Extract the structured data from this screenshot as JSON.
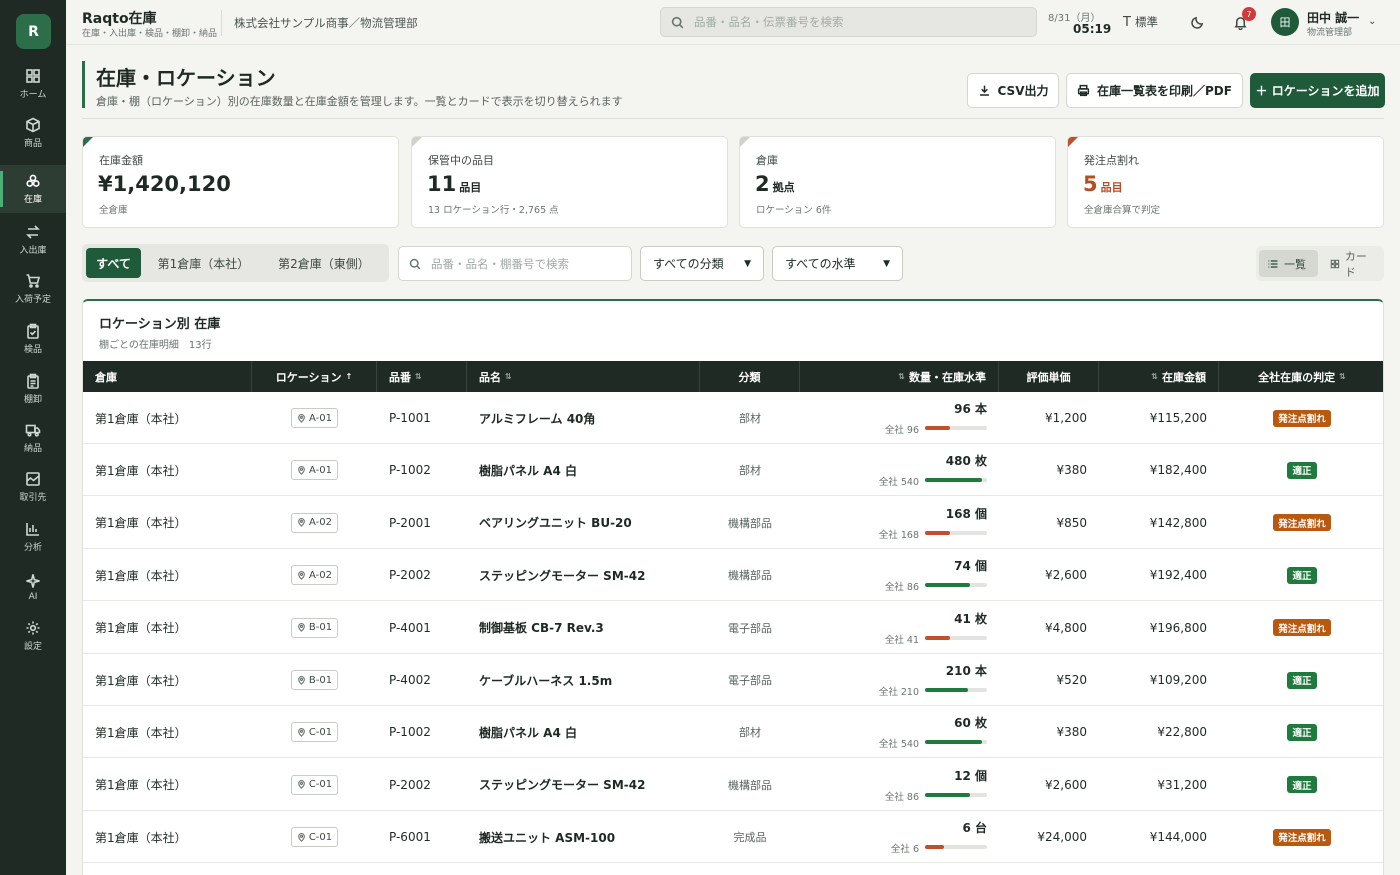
{
  "app": {
    "logo": "R",
    "title": "Raqto在庫",
    "subtitle": "在庫・入出庫・検品・棚卸・納品",
    "company": "株式会社サンプル商事／物流管理部"
  },
  "top_search": {
    "placeholder": "品番・品名・伝票番号を検索"
  },
  "clock": {
    "date": "8/31（月）",
    "time": "05:19"
  },
  "font_size_label": "標準",
  "notifications": {
    "count": "7"
  },
  "user": {
    "avatar": "田",
    "name": "田中 誠一",
    "role": "物流管理部"
  },
  "sidebar": {
    "items": [
      {
        "label": "ホーム",
        "icon": "home-icon"
      },
      {
        "label": "商品",
        "icon": "box-icon"
      },
      {
        "label": "在庫",
        "icon": "stock-icon",
        "active": true
      },
      {
        "label": "入出庫",
        "icon": "arrows-icon"
      },
      {
        "label": "入荷予定",
        "icon": "cart-icon"
      },
      {
        "label": "検品",
        "icon": "clipboard-check-icon"
      },
      {
        "label": "棚卸",
        "icon": "clipboard-list-icon"
      },
      {
        "label": "納品",
        "icon": "truck-icon"
      },
      {
        "label": "取引先",
        "icon": "building-icon"
      },
      {
        "label": "分析",
        "icon": "chart-icon"
      },
      {
        "label": "AI",
        "icon": "sparkle-icon"
      },
      {
        "label": "設定",
        "icon": "gear-icon"
      }
    ]
  },
  "page": {
    "title": "在庫・ロケーション",
    "description": "倉庫・棚（ロケーション）別の在庫数量と在庫金額を管理します。一覧とカードで表示を切り替えられます",
    "buttons": {
      "csv": "CSV出力",
      "print": "在庫一覧表を印刷／PDF",
      "add": "＋ ロケーションを追加"
    }
  },
  "kpis": [
    {
      "label": "在庫金額",
      "value": "¥1,420,120",
      "unit": "",
      "sub": "全倉庫"
    },
    {
      "label": "保管中の品目",
      "value": "11",
      "unit": "品目",
      "sub": "13 ロケーション行・2,765 点"
    },
    {
      "label": "倉庫",
      "value": "2",
      "unit": "拠点",
      "sub": "ロケーション 6件"
    },
    {
      "label": "発注点割れ",
      "value": "5",
      "unit": "品目",
      "sub": "全倉庫合算で判定"
    }
  ],
  "filters": {
    "tabs": [
      "すべて",
      "第1倉庫（本社）",
      "第2倉庫（東側）"
    ],
    "search_placeholder": "品番・品名・棚番号で検索",
    "category": "すべての分類",
    "level": "すべての水準",
    "view": {
      "list": "一覧",
      "card": "カード"
    }
  },
  "table": {
    "title": "ロケーション別 在庫",
    "subtitle": "棚ごとの在庫明細　13行",
    "headers": {
      "warehouse": "倉庫",
      "location": "ロケーション",
      "code": "品番",
      "name": "品名",
      "category": "分類",
      "qty": "数量・在庫水準",
      "unit_price": "評価単価",
      "amount": "在庫金額",
      "judge": "全社在庫の判定"
    },
    "rows": [
      {
        "warehouse": "第1倉庫（本社）",
        "location": "A-01",
        "code": "P-1001",
        "name": "アルミフレーム 40角",
        "category": "部材",
        "qty": "96 本",
        "total": "全社 96",
        "level": 0.4,
        "level_status": "low",
        "unit_price": "¥1,200",
        "amount": "¥115,200",
        "judge": "発注点割れ",
        "judge_status": "warn"
      },
      {
        "warehouse": "第1倉庫（本社）",
        "location": "A-01",
        "code": "P-1002",
        "name": "樹脂パネル A4 白",
        "category": "部材",
        "qty": "480 枚",
        "total": "全社 540",
        "level": 0.92,
        "level_status": "ok",
        "unit_price": "¥380",
        "amount": "¥182,400",
        "judge": "適正",
        "judge_status": "ok"
      },
      {
        "warehouse": "第1倉庫（本社）",
        "location": "A-02",
        "code": "P-2001",
        "name": "ベアリングユニット BU-20",
        "category": "機構部品",
        "qty": "168 個",
        "total": "全社 168",
        "level": 0.4,
        "level_status": "low",
        "unit_price": "¥850",
        "amount": "¥142,800",
        "judge": "発注点割れ",
        "judge_status": "warn"
      },
      {
        "warehouse": "第1倉庫（本社）",
        "location": "A-02",
        "code": "P-2002",
        "name": "ステッピングモーター SM-42",
        "category": "機構部品",
        "qty": "74 個",
        "total": "全社 86",
        "level": 0.72,
        "level_status": "ok",
        "unit_price": "¥2,600",
        "amount": "¥192,400",
        "judge": "適正",
        "judge_status": "ok"
      },
      {
        "warehouse": "第1倉庫（本社）",
        "location": "B-01",
        "code": "P-4001",
        "name": "制御基板 CB-7 Rev.3",
        "category": "電子部品",
        "qty": "41 枚",
        "total": "全社 41",
        "level": 0.4,
        "level_status": "low",
        "unit_price": "¥4,800",
        "amount": "¥196,800",
        "judge": "発注点割れ",
        "judge_status": "warn"
      },
      {
        "warehouse": "第1倉庫（本社）",
        "location": "B-01",
        "code": "P-4002",
        "name": "ケーブルハーネス 1.5m",
        "category": "電子部品",
        "qty": "210 本",
        "total": "全社 210",
        "level": 0.7,
        "level_status": "ok",
        "unit_price": "¥520",
        "amount": "¥109,200",
        "judge": "適正",
        "judge_status": "ok"
      },
      {
        "warehouse": "第1倉庫（本社）",
        "location": "C-01",
        "code": "P-1002",
        "name": "樹脂パネル A4 白",
        "category": "部材",
        "qty": "60 枚",
        "total": "全社 540",
        "level": 0.92,
        "level_status": "ok",
        "unit_price": "¥380",
        "amount": "¥22,800",
        "judge": "適正",
        "judge_status": "ok"
      },
      {
        "warehouse": "第1倉庫（本社）",
        "location": "C-01",
        "code": "P-2002",
        "name": "ステッピングモーター SM-42",
        "category": "機構部品",
        "qty": "12 個",
        "total": "全社 86",
        "level": 0.72,
        "level_status": "ok",
        "unit_price": "¥2,600",
        "amount": "¥31,200",
        "judge": "適正",
        "judge_status": "ok"
      },
      {
        "warehouse": "第1倉庫（本社）",
        "location": "C-01",
        "code": "P-6001",
        "name": "搬送ユニット ASM-100",
        "category": "完成品",
        "qty": "6 台",
        "total": "全社 6",
        "level": 0.3,
        "level_status": "low",
        "unit_price": "¥24,000",
        "amount": "¥144,000",
        "judge": "発注点割れ",
        "judge_status": "warn"
      }
    ]
  },
  "colors": {
    "brand": "#1f5a3a",
    "ok": "#1f7a3e",
    "warn": "#b8590f",
    "low_bar": "#c0502a",
    "ok_bar": "#1f7a3e"
  }
}
